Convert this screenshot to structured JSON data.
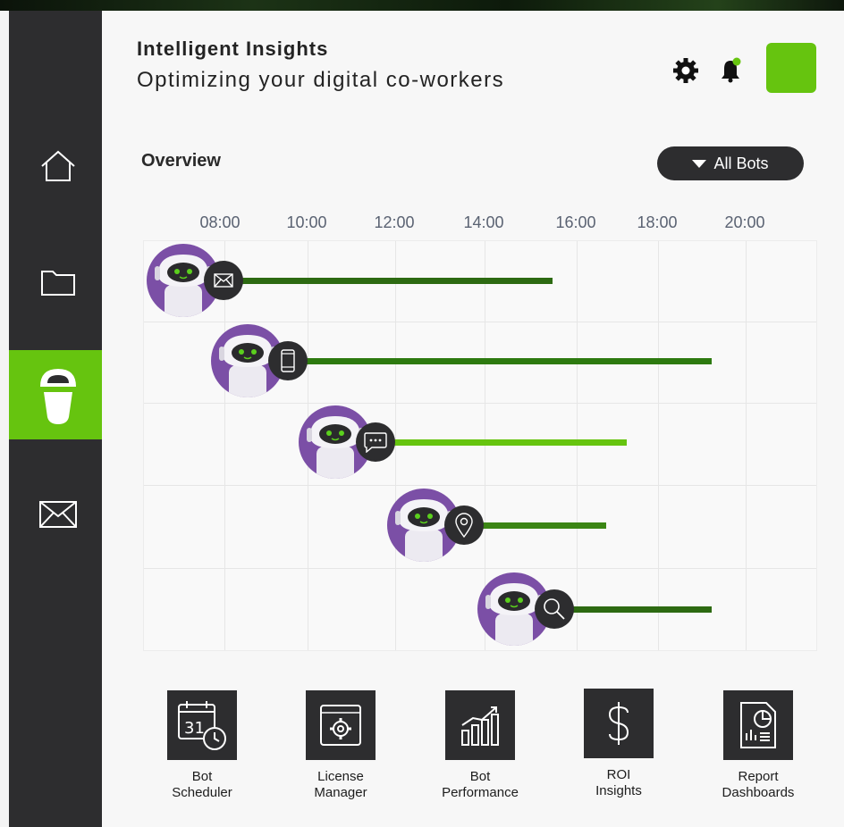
{
  "header": {
    "title": "Intelligent Insights",
    "subtitle": "Optimizing your digital co-workers"
  },
  "sidebar": {
    "items": [
      {
        "name": "home",
        "icon": "home-icon",
        "active": false
      },
      {
        "name": "folder",
        "icon": "folder-icon",
        "active": false
      },
      {
        "name": "bots",
        "icon": "robot-icon",
        "active": true
      },
      {
        "name": "mail",
        "icon": "mail-icon",
        "active": false
      }
    ]
  },
  "overview": {
    "heading": "Overview",
    "filter_label": "All Bots"
  },
  "timeline": {
    "ticks": [
      "08:00",
      "10:00",
      "12:00",
      "14:00",
      "16:00",
      "18:00",
      "20:00"
    ],
    "bots": [
      {
        "icon": "mail-icon",
        "start": "07:15",
        "end": "15:30",
        "color": "#2d6a12"
      },
      {
        "icon": "mobile-phone-icon",
        "start": "08:45",
        "end": "19:15",
        "color": "#2d7a10"
      },
      {
        "icon": "chat-bubble-icon",
        "start": "10:45",
        "end": "17:15",
        "color": "#66c40f"
      },
      {
        "icon": "location-pin-icon",
        "start": "12:45",
        "end": "16:45",
        "color": "#3b8614"
      },
      {
        "icon": "search-icon",
        "start": "14:45",
        "end": "19:15",
        "color": "#2d6a12"
      }
    ]
  },
  "tools": [
    {
      "label": "Bot\nScheduler",
      "icon": "calendar-clock-icon"
    },
    {
      "label": "License\nManager",
      "icon": "settings-window-icon"
    },
    {
      "label": "Bot\nPerformance",
      "icon": "bar-chart-growth-icon"
    },
    {
      "label": "ROI\nInsights",
      "icon": "dollar-icon"
    },
    {
      "label": "Report\nDashboards",
      "icon": "report-document-icon"
    }
  ],
  "colors": {
    "accent": "#66c40f",
    "sidebar": "#2d2d2f",
    "bot_avatar": "#7b4fa6"
  }
}
